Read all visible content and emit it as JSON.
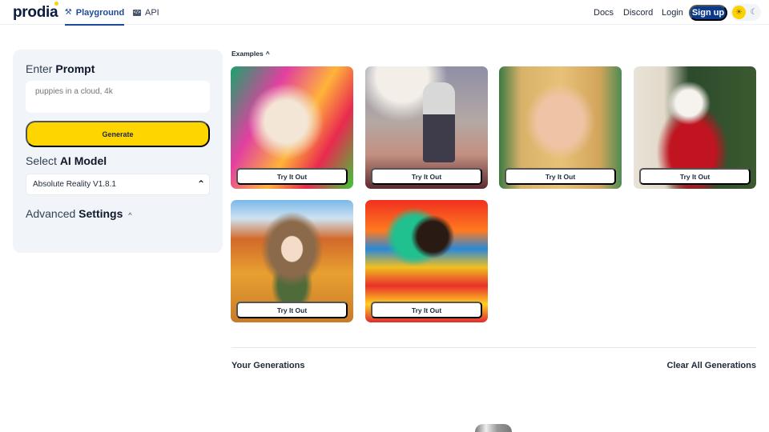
{
  "header": {
    "logo": "prodia",
    "tabs": [
      {
        "label": "Playground",
        "icon": "magic-wand-icon",
        "active": true
      },
      {
        "label": "API",
        "icon": "code-icon",
        "active": false
      }
    ],
    "nav_links": [
      "Docs",
      "Discord",
      "Login"
    ],
    "signup_label": "Sign up",
    "theme": {
      "options": [
        "light",
        "dark"
      ],
      "selected": "light"
    }
  },
  "sidebar": {
    "prompt_heading_light": "Enter",
    "prompt_heading_bold": "Prompt",
    "prompt_placeholder": "puppies in a cloud, 4k",
    "prompt_value": "",
    "generate_label": "Generate",
    "model_heading_light": "Select",
    "model_heading_bold": "AI Model",
    "model_selected": "Absolute Reality V1.8.1",
    "advanced_heading_light": "Advanced",
    "advanced_heading_bold": "Settings"
  },
  "examples": {
    "label": "Examples",
    "cards": [
      {
        "subject": "colorful splatter portrait of woman",
        "button": "Try It Out"
      },
      {
        "subject": "astronaut riding a horse",
        "button": "Try It Out"
      },
      {
        "subject": "blonde woman portrait",
        "button": "Try It Out"
      },
      {
        "subject": "santa claus by christmas tree",
        "button": "Try It Out"
      },
      {
        "subject": "anime girl in autumn",
        "button": "Try It Out"
      },
      {
        "subject": "psychedelic tree landscape",
        "button": "Try It Out"
      }
    ]
  },
  "generations": {
    "title": "Your Generations",
    "clear_label": "Clear All Generations"
  },
  "colors": {
    "brand_blue": "#0b3a8c",
    "accent_yellow": "#ffd500",
    "panel_bg": "#f1f4f8"
  }
}
